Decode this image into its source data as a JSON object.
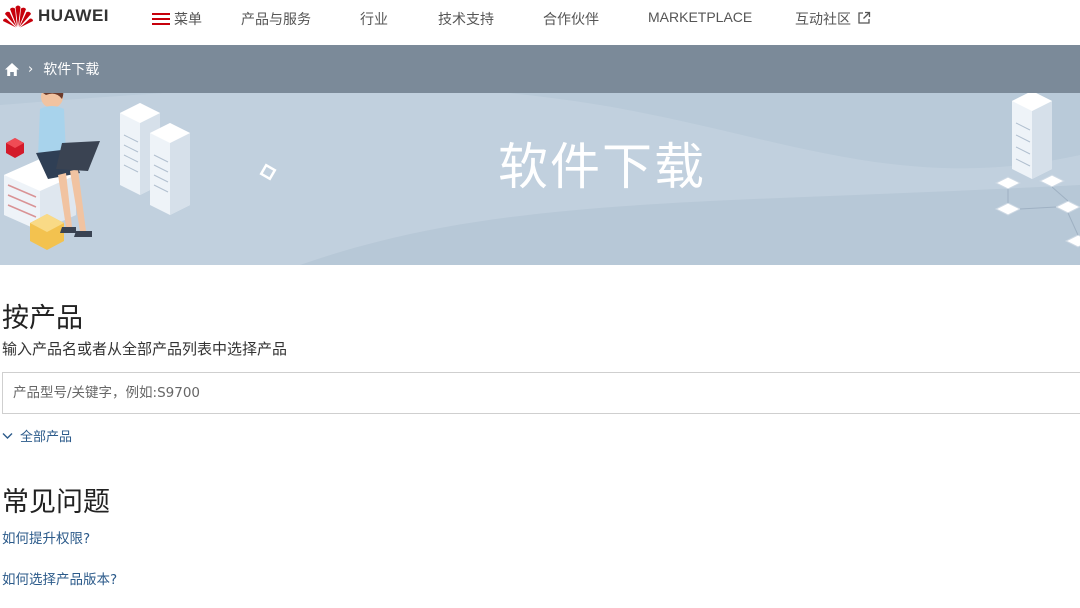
{
  "brand": {
    "name": "HUAWEI",
    "color": "#c7000b"
  },
  "nav": {
    "menu": "菜单",
    "items": [
      "产品与服务",
      "行业",
      "技术支持",
      "合作伙伴",
      "MARKETPLACE",
      "互动社区"
    ]
  },
  "breadcrumb": {
    "home_icon": "home-icon",
    "current": "软件下载"
  },
  "banner": {
    "title": "软件下载"
  },
  "by_product": {
    "title": "按产品",
    "subtitle": "输入产品名或者从全部产品列表中选择产品",
    "search_placeholder": "产品型号/关键字，例如:S9700",
    "all_products": "全部产品"
  },
  "faq": {
    "title": "常见问题",
    "items": [
      "如何提升权限?",
      "如何选择产品版本?"
    ]
  },
  "colors": {
    "accent": "#c7000b",
    "link": "#2b5a8a",
    "banner_bg": "#b9cad9",
    "crumb_bar": "#7b8a99"
  }
}
